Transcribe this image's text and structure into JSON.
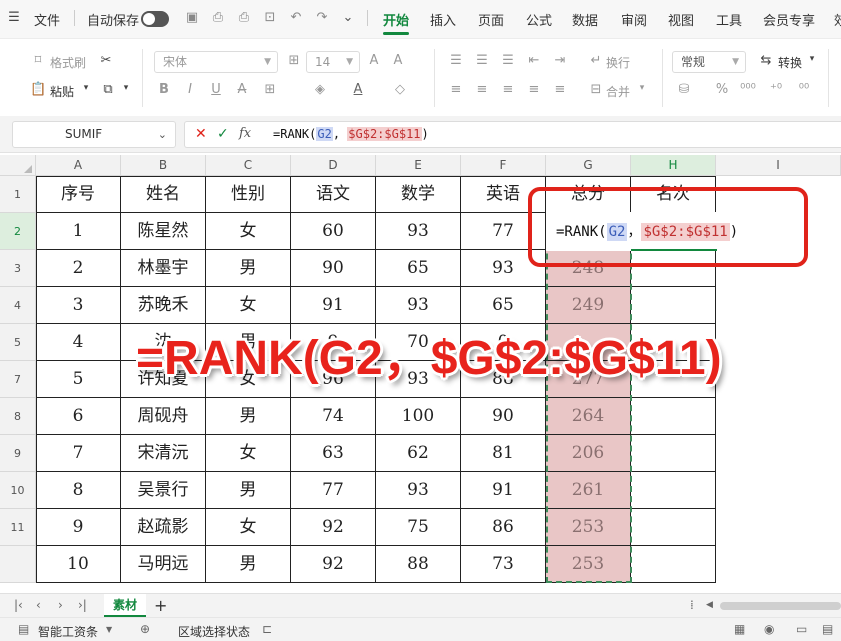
{
  "menubar": {
    "file_label": "文件",
    "autosave_label": "自动保存",
    "tabs": [
      "开始",
      "插入",
      "页面",
      "公式",
      "数据",
      "审阅",
      "视图",
      "工具",
      "会员专享",
      "效"
    ],
    "active_tab": "开始"
  },
  "ribbon": {
    "format_painter": "格式刷",
    "paste": "粘贴",
    "font_name": "宋体",
    "font_size": "14",
    "wrap_text": "换行",
    "merge": "合并",
    "number_format": "常规",
    "convert": "转换"
  },
  "formula_bar": {
    "name_box": "SUMIF",
    "fx_label": "fx",
    "prefix": "=RANK(",
    "ref1": "G2",
    "sep": ", ",
    "ref2": "$G$2:$G$11",
    "suffix": ")"
  },
  "grid": {
    "columns": [
      "A",
      "B",
      "C",
      "D",
      "E",
      "F",
      "G",
      "H",
      "I"
    ],
    "row_numbers": [
      "1",
      "2",
      "3",
      "4",
      "5",
      "7",
      "8",
      "9",
      "10",
      "11"
    ],
    "header": [
      "序号",
      "姓名",
      "性别",
      "语文",
      "数学",
      "英语",
      "总分",
      "名次"
    ],
    "rows": [
      [
        "1",
        "陈星然",
        "女",
        "60",
        "93",
        "77"
      ],
      [
        "2",
        "林墨宇",
        "男",
        "90",
        "65",
        "93"
      ],
      [
        "3",
        "苏晚禾",
        "女",
        "91",
        "93",
        "65"
      ],
      [
        "4",
        "沈",
        "男",
        "9",
        "70",
        "0"
      ],
      [
        "5",
        "许知夏",
        "女",
        "96",
        "93",
        "88"
      ],
      [
        "6",
        "周砚舟",
        "男",
        "74",
        "100",
        "90"
      ],
      [
        "7",
        "宋清沅",
        "女",
        "63",
        "62",
        "81"
      ],
      [
        "8",
        "吴景行",
        "男",
        "77",
        "93",
        "91"
      ],
      [
        "9",
        "赵疏影",
        "女",
        "92",
        "75",
        "86"
      ],
      [
        "10",
        "马明远",
        "男",
        "92",
        "88",
        "73"
      ]
    ],
    "totals": [
      "",
      "248",
      "249",
      "",
      "277",
      "264",
      "206",
      "261",
      "253",
      "253"
    ]
  },
  "cell_edit": {
    "prefix": "=RANK(",
    "ref1": "G2",
    "sep": "，",
    "ref2": "$G$2:$G$11",
    "suffix": ")"
  },
  "annotation": "=RANK(G2，$G$2:$G$11)",
  "sheet_tabs": [
    "素材"
  ],
  "status": {
    "left_label": "智能工资条",
    "mode_label": "区域选择状态"
  },
  "colors": {
    "accent": "#12883e",
    "callout": "#e0231a",
    "range_fill": "#e9c6c6"
  }
}
